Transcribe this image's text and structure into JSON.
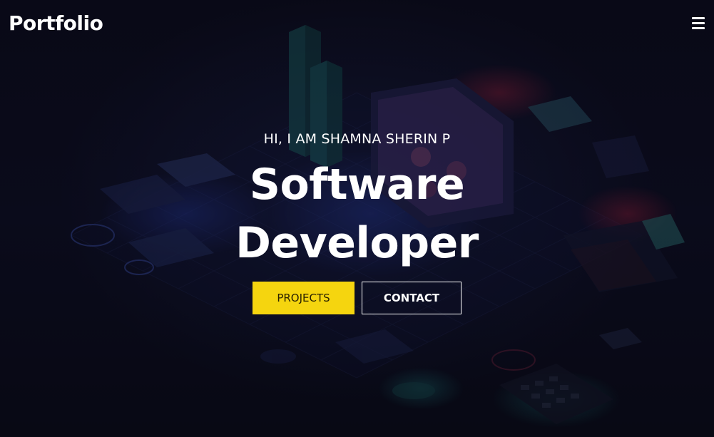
{
  "nav": {
    "brand": "Portfolio",
    "menu_icon": "hamburger-menu-icon"
  },
  "hero": {
    "greeting": "HI, I AM SHAMNA SHERIN P",
    "title_line1": "Software",
    "title_line2": "Developer",
    "buttons": {
      "projects": "PROJECTS",
      "contact": "CONTACT"
    }
  },
  "colors": {
    "background": "#0a0a16",
    "accent_yellow": "#f5d50f",
    "text": "#ffffff"
  }
}
